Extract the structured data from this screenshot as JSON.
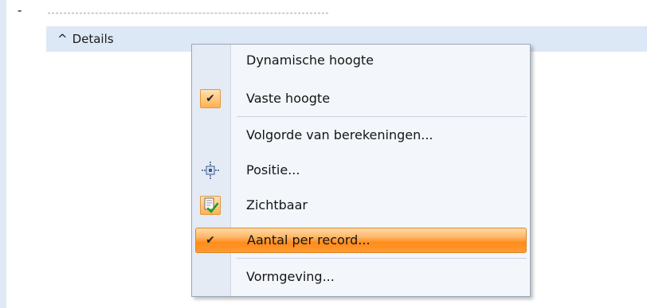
{
  "tree": {
    "minus_marker": "-",
    "details_caret": "^",
    "details_label": "Details"
  },
  "context_menu": {
    "items": [
      {
        "label": "Dynamische hoogte",
        "checked": false
      },
      {
        "label": "Vaste hoogte",
        "checked": true,
        "icon": "checkmark-icon"
      },
      {
        "label": "Volgorde van berekeningen...",
        "checked": false
      },
      {
        "label": "Positie...",
        "checked": false,
        "icon": "position-icon"
      },
      {
        "label": "Zichtbaar",
        "checked": false,
        "icon": "visible-icon"
      },
      {
        "label": "Aantal per record...",
        "checked": true,
        "highlighted": true,
        "icon": "checkmark-icon"
      },
      {
        "label": "Vormgeving...",
        "checked": false
      }
    ],
    "check_glyph": "✔",
    "colors": {
      "highlight": "#ff8c1a",
      "gutter": "#e4ebf5",
      "menu_bg": "#f3f6fb"
    }
  }
}
